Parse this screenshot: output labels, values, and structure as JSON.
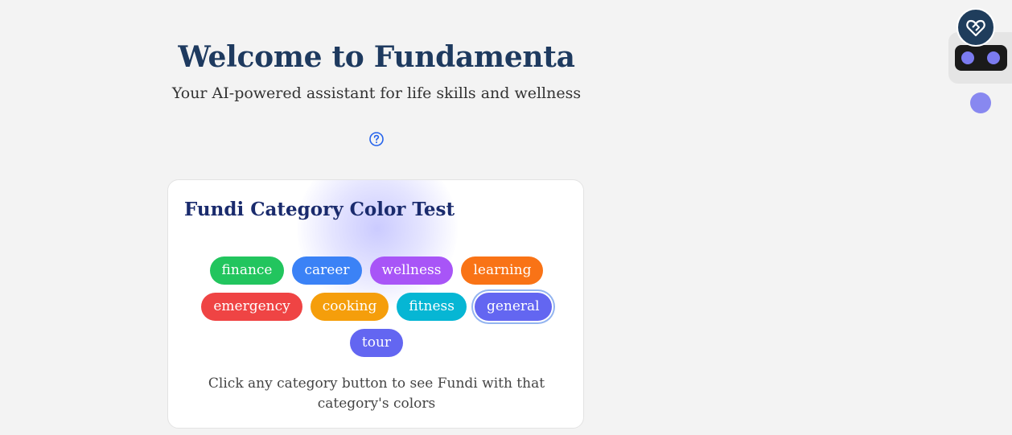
{
  "header": {
    "title": "Welcome to Fundamenta",
    "subtitle": "Your AI-powered assistant for life skills and wellness",
    "help_icon": "question-circle-icon"
  },
  "card": {
    "title": "Fundi Category Color Test",
    "categories": [
      {
        "label": "finance",
        "color": "#22c55e"
      },
      {
        "label": "career",
        "color": "#3b82f6"
      },
      {
        "label": "wellness",
        "color": "#a855f7"
      },
      {
        "label": "learning",
        "color": "#f97316"
      },
      {
        "label": "emergency",
        "color": "#ef4444"
      },
      {
        "label": "cooking",
        "color": "#f59e0b"
      },
      {
        "label": "fitness",
        "color": "#06b6d4"
      },
      {
        "label": "general",
        "color": "#6366f1",
        "selected": true
      },
      {
        "label": "tour",
        "color": "#6366f1"
      }
    ],
    "caption": "Click any category button to see Fundi with that category's colors"
  },
  "widget": {
    "avatar_icon": "heart-hands-logo-icon",
    "avatar_color": "#1f3d5c",
    "eye_color": "#7b7bf0",
    "dot_color": "#8888f0"
  }
}
